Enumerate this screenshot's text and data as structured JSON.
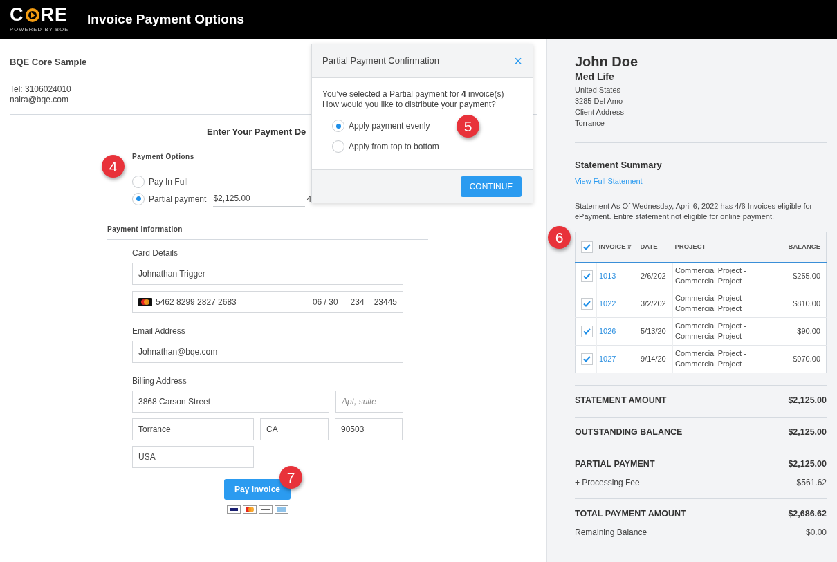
{
  "header": {
    "logo": {
      "letters_before": "C",
      "letters_after": "RE",
      "tagline": "POWERED BY BQE"
    },
    "title": "Invoice Payment Options"
  },
  "company": {
    "name": "BQE Core Sample",
    "phone": "Tel: 3106024010",
    "email": "naira@bqe.com"
  },
  "form": {
    "heading": "Enter Your Payment De",
    "payment_options": {
      "label": "Payment Options",
      "callout": "4",
      "amount": "$2,125.00",
      "invoice_count": "4",
      "options": [
        {
          "label": "Pay In Full",
          "selected": false
        },
        {
          "label": "Partial payment",
          "selected": true
        }
      ]
    },
    "payment_information": {
      "label": "Payment Information",
      "card_details": {
        "label": "Card Details",
        "name": "Johnathan Trigger",
        "number": "5462 8299 2827 2683",
        "expiry": "06 / 30",
        "cvc": "234",
        "zip": "23445"
      },
      "email": {
        "label": "Email Address",
        "value": "Johnathan@bqe.com"
      },
      "billing": {
        "label": "Billing Address",
        "street": "3868 Carson Street",
        "apt_placeholder": "Apt, suite",
        "city": "Torrance",
        "state": "CA",
        "zip": "90503",
        "country": "USA"
      }
    },
    "pay_button": {
      "label": "Pay Invoice",
      "callout": "7"
    }
  },
  "modal": {
    "title": "Partial Payment Confirmation",
    "close": "×",
    "callout": "5",
    "message": [
      "You’ve selected a Partial payment for **4** invoice(s)",
      "How would you like to distribute your payment?"
    ],
    "options": [
      {
        "label": "Apply payment evenly",
        "selected": true
      },
      {
        "label": "Apply from top to bottom",
        "selected": false
      }
    ],
    "button": "CONTINUE"
  },
  "client": {
    "name": "John Doe",
    "company": "Med Life",
    "lines": [
      "United States",
      "3285 Del Amo",
      "Client Address",
      "Torrance"
    ]
  },
  "statement": {
    "title": "Statement Summary",
    "link": "View Full Statement",
    "note": "Statement As Of Wednesday, April 6, 2022 has 4/6 Invoices eligible for ePayment. Entire statement not eligible for online payment.",
    "table": {
      "callout": "6",
      "all_checked": true,
      "columns": [
        "INVOICE #",
        "DATE",
        "PROJECT",
        "BALANCE"
      ],
      "rows": [
        {
          "checked": true,
          "invoice": "1013",
          "date": "2/6/202",
          "project": "Commercial Project - Commercial Project",
          "balance": "$255.00"
        },
        {
          "checked": true,
          "invoice": "1022",
          "date": "3/2/202",
          "project": "Commercial Project - Commercial Project",
          "balance": "$810.00"
        },
        {
          "checked": true,
          "invoice": "1026",
          "date": "5/13/20",
          "project": "Commercial Project - Commercial Project",
          "balance": "$90.00"
        },
        {
          "checked": true,
          "invoice": "1027",
          "date": "9/14/20",
          "project": "Commercial Project - Commercial Project",
          "balance": "$970.00"
        }
      ]
    },
    "totals": [
      [
        {
          "label": "STATEMENT AMOUNT",
          "value": "$2,125.00",
          "bold": true
        }
      ],
      [
        {
          "label": "OUTSTANDING BALANCE",
          "value": "$2,125.00",
          "bold": true
        }
      ],
      [
        {
          "label": "PARTIAL PAYMENT",
          "value": "$2,125.00",
          "bold": true
        },
        {
          "label": "+ Processing Fee",
          "value": "$561.62",
          "bold": false
        }
      ],
      [
        {
          "label": "TOTAL PAYMENT AMOUNT",
          "value": "$2,686.62",
          "bold": true
        },
        {
          "label": "Remaining Balance",
          "value": "$0.00",
          "bold": false
        }
      ]
    ]
  }
}
